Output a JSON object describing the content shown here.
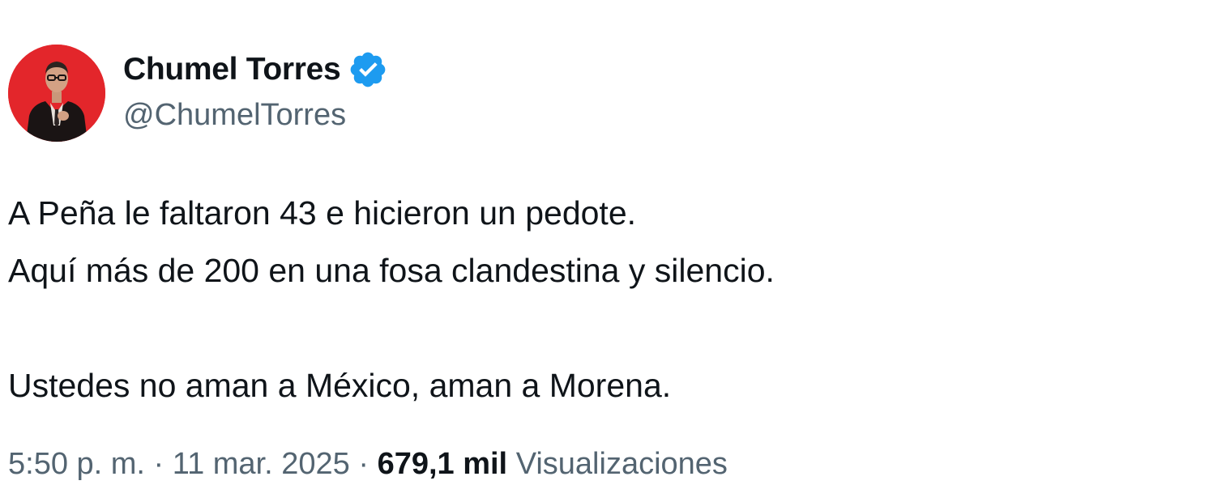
{
  "author": {
    "display_name": "Chumel Torres",
    "handle": "@ChumelTorres",
    "verified_icon": "verified-badge-icon",
    "avatar_background": "#e3262b"
  },
  "tweet": {
    "lines": [
      "A Peña le faltaron 43 e hicieron un pedote.",
      "Aquí más de 200 en una fosa clandestina y silencio.",
      "",
      "Ustedes no aman a México, aman a Morena."
    ]
  },
  "meta": {
    "time": "5:50 p. m.",
    "separator": "·",
    "date": "11 mar. 2025",
    "views_count": "679,1 mil",
    "views_label": "Visualizaciones"
  },
  "colors": {
    "text_primary": "#0f1419",
    "text_secondary": "#536471",
    "verified_blue": "#1d9bf0"
  }
}
